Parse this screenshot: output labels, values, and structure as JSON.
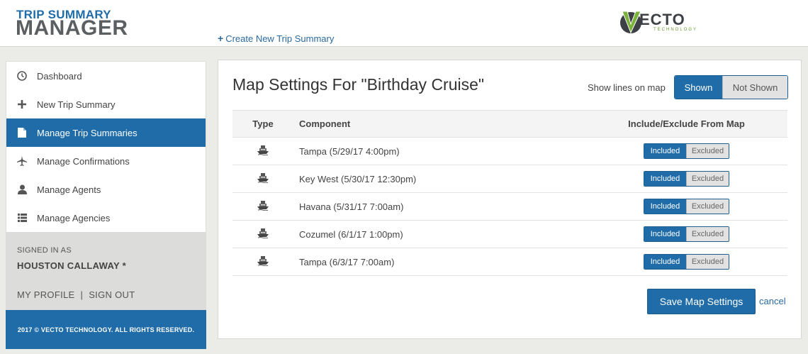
{
  "header": {
    "logo_line1": "TRIP SUMMARY",
    "logo_line2": "MANAGER",
    "create_link": "Create New Trip Summary",
    "brand_word": "ECTO",
    "brand_sub": "TECHNOLOGY"
  },
  "sidebar": {
    "items": [
      {
        "label": "Dashboard",
        "icon": "dashboard-icon",
        "active": false
      },
      {
        "label": "New Trip Summary",
        "icon": "plus-icon",
        "active": false
      },
      {
        "label": "Manage Trip Summaries",
        "icon": "document-icon",
        "active": true
      },
      {
        "label": "Manage Confirmations",
        "icon": "airplane-icon",
        "active": false
      },
      {
        "label": "Manage Agents",
        "icon": "user-icon",
        "active": false
      },
      {
        "label": "Manage Agencies",
        "icon": "list-icon",
        "active": false
      }
    ],
    "signed_in_label": "SIGNED IN AS",
    "user_name": "HOUSTON CALLAWAY *",
    "my_profile": "MY PROFILE",
    "separator": "|",
    "sign_out": "SIGN OUT",
    "footer": "2017 © VECTO TECHNOLOGY. ALL RIGHTS RESERVED."
  },
  "main": {
    "title": "Map Settings For \"Birthday Cruise\"",
    "lines_label": "Show lines on map",
    "lines_toggle": {
      "shown": "Shown",
      "not_shown": "Not Shown",
      "selected": "Shown"
    },
    "columns": {
      "type": "Type",
      "component": "Component",
      "include": "Include/Exclude From Map"
    },
    "rows": [
      {
        "type_icon": "ship-icon",
        "component": "Tampa (5/29/17 4:00pm)",
        "included": "Included",
        "excluded": "Excluded",
        "selected": "Included"
      },
      {
        "type_icon": "ship-icon",
        "component": "Key West (5/30/17 12:30pm)",
        "included": "Included",
        "excluded": "Excluded",
        "selected": "Included"
      },
      {
        "type_icon": "ship-icon",
        "component": "Havana (5/31/17 7:00am)",
        "included": "Included",
        "excluded": "Excluded",
        "selected": "Included"
      },
      {
        "type_icon": "ship-icon",
        "component": "Cozumel (6/1/17 1:00pm)",
        "included": "Included",
        "excluded": "Excluded",
        "selected": "Included"
      },
      {
        "type_icon": "ship-icon",
        "component": "Tampa (6/3/17 7:00am)",
        "included": "Included",
        "excluded": "Excluded",
        "selected": "Included"
      }
    ],
    "save_button": "Save Map Settings",
    "cancel_link": "cancel"
  },
  "colors": {
    "primary": "#1f6ca8",
    "background": "#ebebe8",
    "brand_green": "#6a9b2c"
  }
}
